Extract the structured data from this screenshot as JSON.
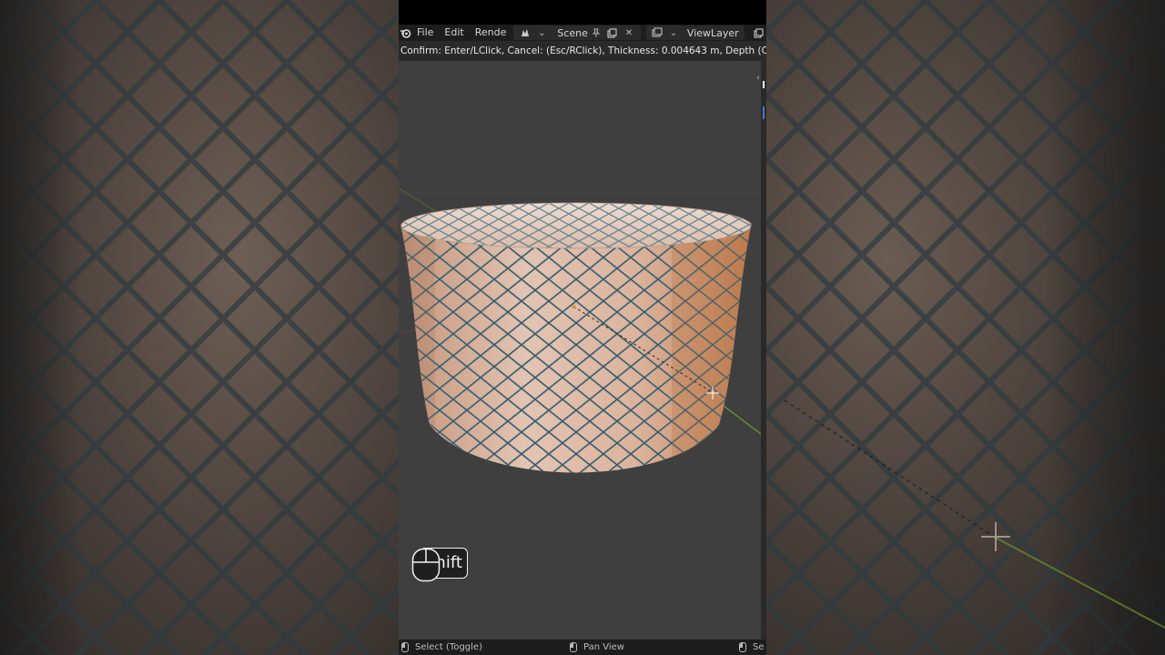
{
  "menu": {
    "file": "File",
    "edit": "Edit",
    "render": "Rende",
    "scene": "Scene",
    "view_layer": "ViewLayer"
  },
  "status": {
    "modal_text": "Confirm: Enter/LClick, Cancel: (Esc/RClick), Thickness: 0.004643 m, Depth (Ctrl to tweak):"
  },
  "keys": {
    "pressed_key": "Shift",
    "mouse": "mouse-icon"
  },
  "footer": {
    "select": "Select (Toggle)",
    "pan": "Pan View",
    "truncated": "Se"
  },
  "colors": {
    "viewport_bg": "#3f3f3f",
    "mesh_face": "#d6b3a1",
    "mesh_edge": "#7f9aa6",
    "x_axis": "#7a3a3a",
    "y_axis": "#6f8f2a"
  }
}
